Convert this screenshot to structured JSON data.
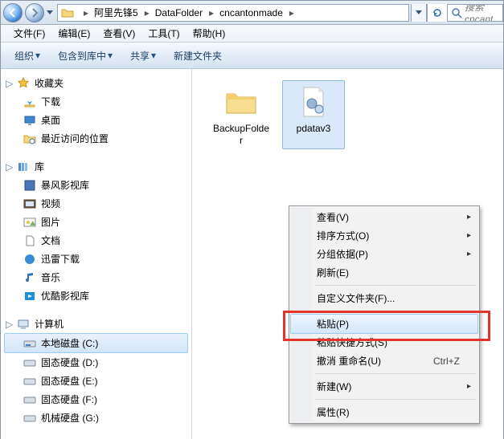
{
  "breadcrumbs": [
    "阿里先锋5",
    "DataFolder",
    "cncantonmade"
  ],
  "search_placeholder": "搜索 cncant",
  "menu": [
    "文件(F)",
    "编辑(E)",
    "查看(V)",
    "工具(T)",
    "帮助(H)"
  ],
  "toolbar": {
    "organize": "组织",
    "include": "包含到库中",
    "share": "共享",
    "newfolder": "新建文件夹"
  },
  "sidebar": {
    "favorites_hdr": "收藏夹",
    "favorites": [
      "下载",
      "桌面",
      "最近访问的位置"
    ],
    "libraries_hdr": "库",
    "libraries": [
      "暴风影视库",
      "视频",
      "图片",
      "文档",
      "迅雷下载",
      "音乐",
      "优酷影视库"
    ],
    "computer_hdr": "计算机",
    "drives": [
      "本地磁盘 (C:)",
      "固态硬盘 (D:)",
      "固态硬盘 (E:)",
      "固态硬盘 (F:)",
      "机械硬盘 (G:)"
    ]
  },
  "files": [
    {
      "name": "BackupFolder",
      "type": "folder"
    },
    {
      "name": "pdatav3",
      "type": "config"
    }
  ],
  "context_menu": {
    "view": "查看(V)",
    "sort": "排序方式(O)",
    "group": "分组依据(P)",
    "refresh": "刷新(E)",
    "customize": "自定义文件夹(F)...",
    "paste": "粘贴(P)",
    "paste_shortcut": "粘贴快捷方式(S)",
    "undo_rename": "撤消 重命名(U)",
    "undo_rename_short": "Ctrl+Z",
    "new": "新建(W)",
    "properties": "属性(R)"
  }
}
